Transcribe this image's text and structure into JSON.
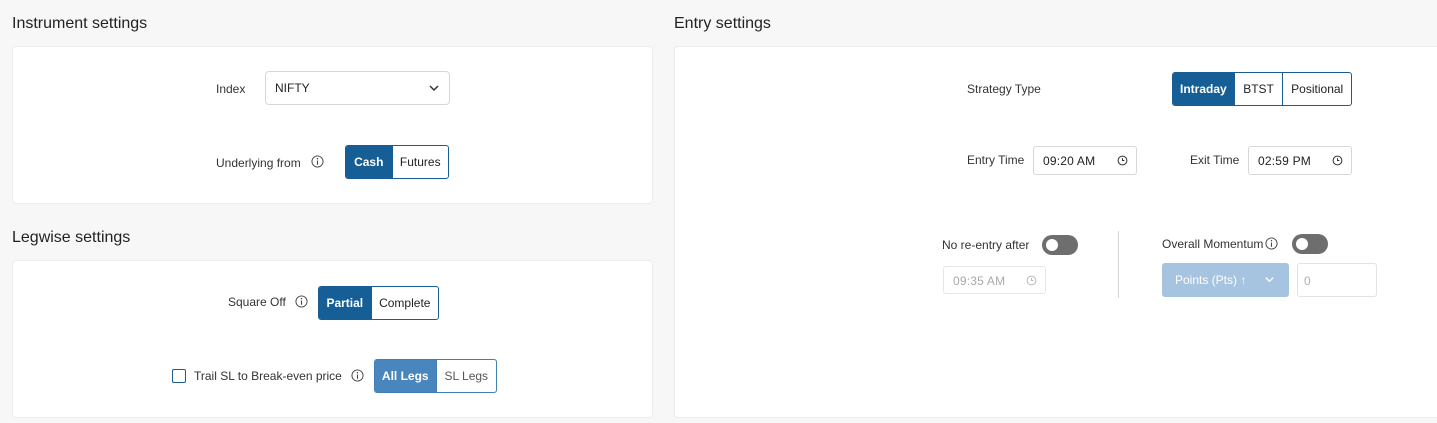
{
  "instrument": {
    "title": "Instrument settings",
    "index_label": "Index",
    "index_value": "NIFTY",
    "underlying_label": "Underlying from",
    "underlying_options": [
      "Cash",
      "Futures"
    ],
    "underlying_selected": "Cash"
  },
  "legwise": {
    "title": "Legwise settings",
    "square_off_label": "Square Off",
    "square_off_options": [
      "Partial",
      "Complete"
    ],
    "square_off_selected": "Partial",
    "trail_label": "Trail SL to Break-even price",
    "trail_checked": false,
    "trail_options": [
      "All Legs",
      "SL Legs"
    ],
    "trail_selected": "All Legs"
  },
  "entry": {
    "title": "Entry settings",
    "strategy_label": "Strategy Type",
    "strategy_options": [
      "Intraday",
      "BTST",
      "Positional"
    ],
    "strategy_selected": "Intraday",
    "entry_time_label": "Entry Time",
    "entry_time": "09:20 AM",
    "exit_time_label": "Exit Time",
    "exit_time": "02:59 PM",
    "no_reentry_label": "No re-entry after",
    "no_reentry_enabled": false,
    "no_reentry_time": "09:35 AM",
    "momentum_label": "Overall Momentum",
    "momentum_enabled": false,
    "momentum_type": "Points (Pts) ↑",
    "momentum_value": "0"
  },
  "colors": {
    "primary": "#155e96",
    "primary_soft": "#4886bd",
    "disabled_button": "#a6c4df",
    "toggle_off": "#6e6e6e",
    "background": "#f7f7f7"
  },
  "icons": {
    "info": "info-icon",
    "dropdown": "chevron-down-icon",
    "time": "clock-icon"
  }
}
